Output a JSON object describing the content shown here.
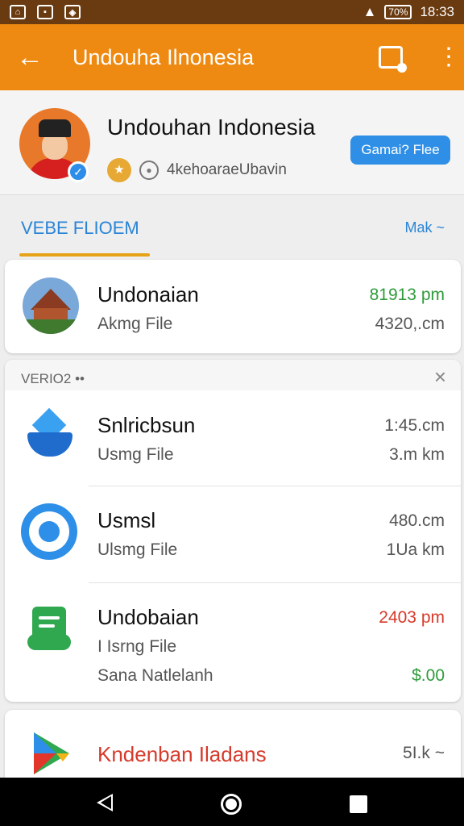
{
  "status_bar": {
    "time": "18:33",
    "battery": "70%"
  },
  "app_bar": {
    "title": "Undouha Ilnonesia"
  },
  "profile": {
    "name": "Undouhan Indonesia",
    "meta": "4kehoaraeUbavin",
    "button": "Gamai? Flee"
  },
  "tabs": {
    "active": "VEBE FLIOEM",
    "right": "Mak ~"
  },
  "featured": {
    "title": "Undonaian",
    "sub": "Akmg File",
    "right1": "81913 pm",
    "right2": "4320,.cm",
    "right1_color": "#2e9b3a"
  },
  "section": {
    "header": "VERIO2 ••",
    "close": "×"
  },
  "items": [
    {
      "title": "Snlricbsun",
      "sub": "Usmg File",
      "right1": "1:45.cm",
      "right2": "3.m km",
      "icon": "shield-app-icon"
    },
    {
      "title": "Usmsl",
      "sub": "Ulsmg File",
      "right1": "480.cm",
      "right2": "1Ua km",
      "icon": "messenger-icon"
    },
    {
      "title": "Undobaian",
      "sub": "I Isrng File",
      "extra": "Sana Natlelanh",
      "right1": "2403 pm",
      "right2": "$.00",
      "right1_color": "#d63a2a",
      "right2_color": "#2e9b3a",
      "icon": "chat-document-icon"
    }
  ],
  "last": {
    "title": "Kndenban Iladans",
    "right": "5I.k ~",
    "title_color": "#d63a2a",
    "icon": "play-store-icon"
  }
}
